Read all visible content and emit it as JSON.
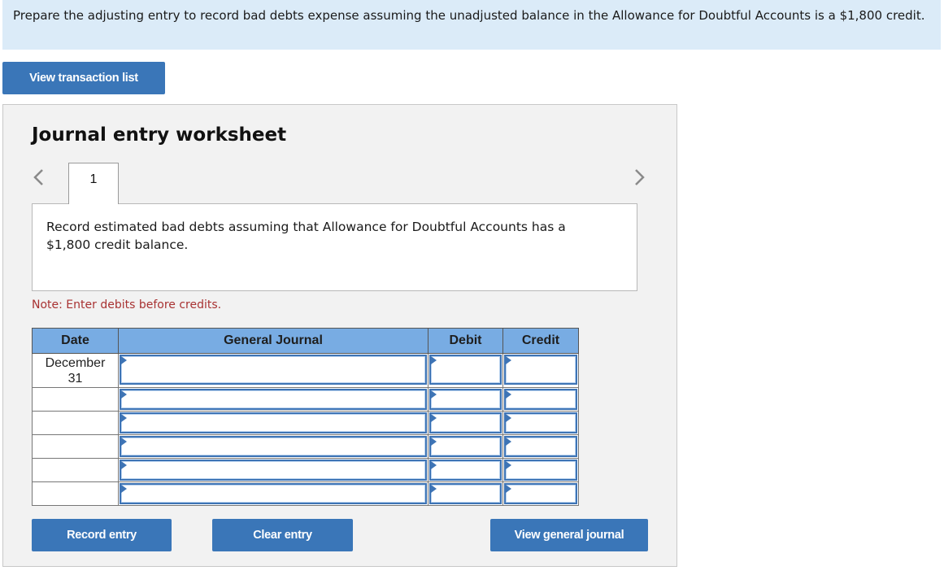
{
  "prompt": {
    "text": "Prepare the adjusting entry to record bad debts expense assuming the unadjusted balance in the Allowance for Doubtful Accounts is a $1,800 credit."
  },
  "buttons": {
    "view_transaction_list": "View transaction list",
    "record_entry": "Record entry",
    "clear_entry": "Clear entry",
    "view_general_journal": "View general journal"
  },
  "worksheet": {
    "title": "Journal entry worksheet",
    "active_tab": "1",
    "description": "Record estimated bad debts assuming that Allowance for Doubtful Accounts has a $1,800 credit balance.",
    "note": "Note: Enter debits before credits.",
    "icons": {
      "prev": "chevron-left-icon",
      "next": "chevron-right-icon",
      "input_marker": "triangle-right-icon"
    }
  },
  "journal": {
    "headers": {
      "date": "Date",
      "general_journal": "General Journal",
      "debit": "Debit",
      "credit": "Credit"
    },
    "rows": [
      {
        "date_line1": "December",
        "date_line2": "31",
        "account": "",
        "debit": "",
        "credit": ""
      },
      {
        "date_line1": "",
        "date_line2": "",
        "account": "",
        "debit": "",
        "credit": ""
      },
      {
        "date_line1": "",
        "date_line2": "",
        "account": "",
        "debit": "",
        "credit": ""
      },
      {
        "date_line1": "",
        "date_line2": "",
        "account": "",
        "debit": "",
        "credit": ""
      },
      {
        "date_line1": "",
        "date_line2": "",
        "account": "",
        "debit": "",
        "credit": ""
      },
      {
        "date_line1": "",
        "date_line2": "",
        "account": "",
        "debit": "",
        "credit": ""
      }
    ]
  },
  "colors": {
    "prompt_bg": "#dbebf8",
    "button_bg": "#3a76b8",
    "header_bg": "#78ace3",
    "note_text": "#a83232",
    "input_border": "#3e74b5"
  }
}
